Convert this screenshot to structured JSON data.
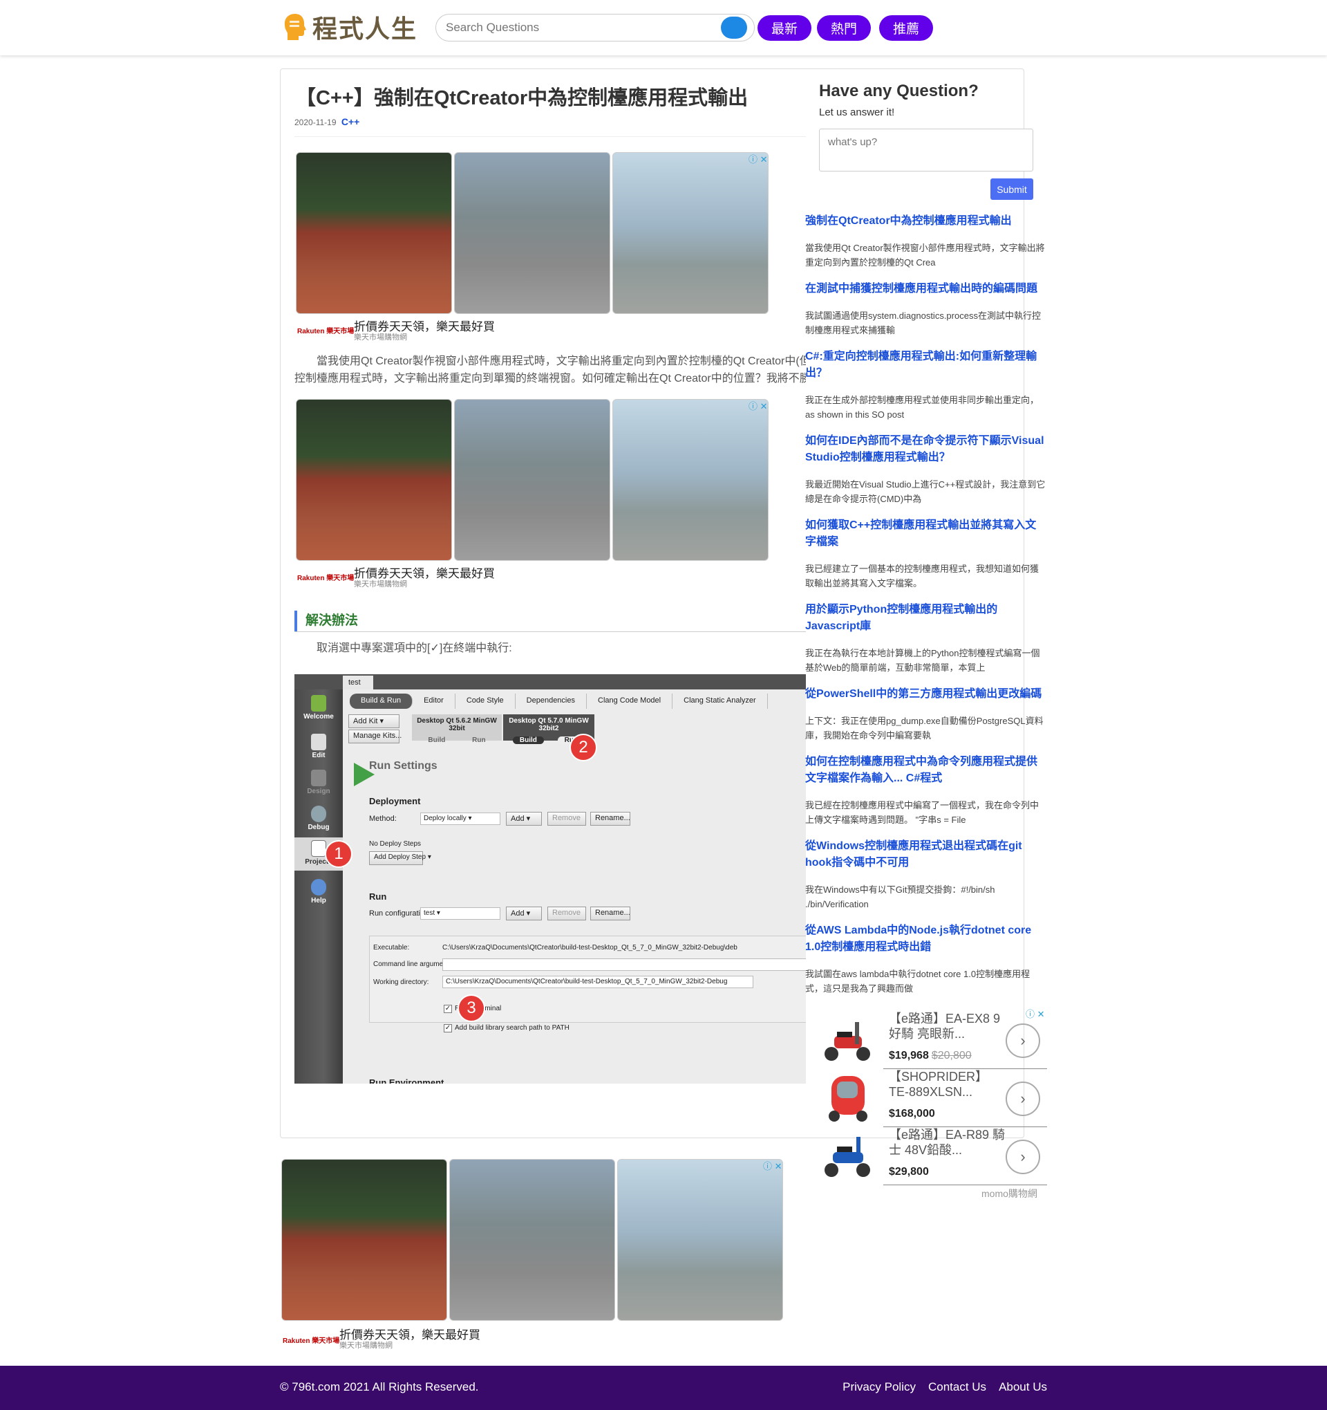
{
  "header": {
    "logo_text": "程式人生",
    "search_placeholder": "Search Questions",
    "nav": [
      "最新",
      "熱門",
      "推薦"
    ]
  },
  "article": {
    "title": "【C++】強制在QtCreator中為控制檯應用程式輸出",
    "date": "2020-11-19",
    "category": "C++",
    "intro": "當我使用Qt Creator製作視窗小部件應用程式時，文字輸出將重定向到內置於控制檯的Qt Creator中(但是當我製作",
    "intro2": "控制檯應用程式時，文字輸出將重定向到單獨的終端視窗。如何確定輸出在Qt Creator中的位置？我將不勝",
    "solution_heading": "解決辦法",
    "solution_text": "取消選中專案選項中的[✓]在終端中執行:"
  },
  "ads": {
    "caption": "折價券天天領，樂天最好買",
    "sub": "樂天市場購物網",
    "brand": "Rakuten 樂天市場",
    "badge": "ⓘ ✕"
  },
  "screenshot": {
    "tab": "test",
    "sidebar": [
      "Welcome",
      "Edit",
      "Design",
      "Debug",
      "Projects",
      "Help"
    ],
    "tabs": [
      "Build & Run",
      "Editor",
      "Code Style",
      "Dependencies",
      "Clang Code Model",
      "Clang Static Analyzer"
    ],
    "add_kit": "Add Kit",
    "manage_kits": "Manage Kits...",
    "kit1": "Desktop Qt 5.6.2 MinGW 32bit",
    "kit2": "Desktop Qt 5.7.0 MinGW 32bit2",
    "build": "Build",
    "run": "Run",
    "run_settings": "Run Settings",
    "deployment": "Deployment",
    "method_label": "Method:",
    "method_value": "Deploy locally",
    "add": "Add",
    "remove": "Remove",
    "rename": "Rename...",
    "no_deploy": "No Deploy Steps",
    "add_deploy": "Add Deploy Step",
    "run_heading": "Run",
    "run_config_label": "Run configuration:",
    "run_config_value": "test",
    "executable_label": "Executable:",
    "executable_value": "C:\\Users\\KrzaQ\\Documents\\QtCreator\\build-test-Desktop_Qt_5_7_0_MinGW_32bit2-Debug\\deb",
    "cmd_label": "Command line arguments:",
    "wd_label": "Working directory:",
    "wd_value": "C:\\Users\\KrzaQ\\Documents\\QtCreator\\build-test-Desktop_Qt_5_7_0_MinGW_32bit2-Debug",
    "run_in_terminal": "Run in terminal",
    "add_build_lib": "Add build library search path to PATH",
    "run_env": "Run Environment",
    "badges": [
      "1",
      "2",
      "3"
    ]
  },
  "sidebar": {
    "ask_title": "Have any Question?",
    "ask_sub": "Let us answer it!",
    "ask_placeholder": "what's up?",
    "submit": "Submit",
    "related": [
      {
        "title": "強制在QtCreator中為控制檯應用程式輸出",
        "desc": "當我使用Qt Creator製作視窗小部件應用程式時，文字輸出將重定向到內置於控制檯的Qt Crea"
      },
      {
        "title": "在測試中捕獲控制檯應用程式輸出時的編碼問題",
        "desc": "我試圖通過使用system.diagnostics.process在測試中執行控制檯應用程式來捕獲輸"
      },
      {
        "title": "C#:重定向控制檯應用程式輸出:如何重新整理輸出？",
        "desc": "我正在生成外部控制檯應用程式並使用非同步輸出重定向，as shown in this SO post"
      },
      {
        "title": "如何在IDE內部而不是在命令提示符下顯示Visual Studio控制檯應用程式輸出？",
        "desc": "我最近開始在Visual Studio上進行C++程式設計，我注意到它總是在命令提示符(CMD)中為"
      },
      {
        "title": "如何獲取C++控制檯應用程式輸出並將其寫入文字檔案",
        "desc": "我已經建立了一個基本的控制檯應用程式，我想知道如何獲取輸出並將其寫入文字檔案。"
      },
      {
        "title": "用於顯示Python控制檯應用程式輸出的Javascript庫",
        "desc": "我正在為執行在本地計算機上的Python控制檯程式編寫一個基於Web的簡單前端，互動非常簡單，本質上"
      },
      {
        "title": "從PowerShell中的第三方應用程式輸出更改編碼",
        "desc": "上下文：我正在使用pg_dump.exe自動備份PostgreSQL資料庫，我開始在命令列中編寫要執"
      },
      {
        "title": "如何在控制檯應用程式中為命令列應用程式提供文字檔案作為輸入... C#程式",
        "desc": "我已經在控制檯應用程式中編寫了一個程式，我在命令列中上傳文字檔案時遇到問題。 \"字串s = File"
      },
      {
        "title": "從Windows控制檯應用程式退出程式碼在git hook指令碼中不可用",
        "desc": "我在Windows中有以下Git預提交掛鉤：#!/bin/sh ./bin/Verification"
      },
      {
        "title": "從AWS Lambda中的Node.js執行dotnet core 1.0控制檯應用程式時出錯",
        "desc": "我試圖在aws lambda中執行dotnet core 1.0控制檯應用程式，這只是我為了興趣而做"
      }
    ],
    "momo_badge": "ⓘ ✕",
    "momo": [
      {
        "name": "【e路通】EA-EX8 9好騎 亮眼新...",
        "price": "$19,968",
        "old": "$20,800"
      },
      {
        "name": "【SHOPRIDER】TE-889XLSN...",
        "price": "$168,000",
        "old": ""
      },
      {
        "name": "【e路通】EA-R89 騎士 48V鉛酸...",
        "price": "$29,800",
        "old": ""
      }
    ],
    "momo_brand": "momo購物網"
  },
  "footer": {
    "copyright": "© 796t.com 2021 All Rights Reserved.",
    "links": [
      "Privacy Policy",
      "Contact Us",
      "About Us"
    ]
  }
}
